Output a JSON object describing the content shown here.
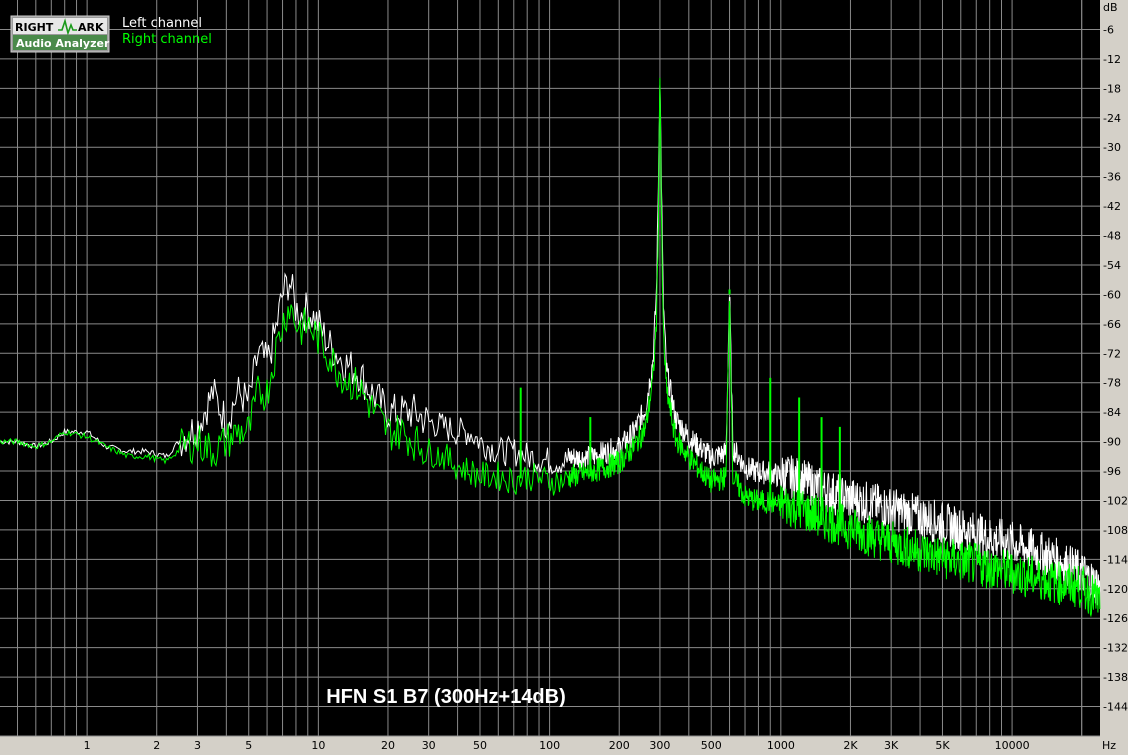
{
  "app": {
    "logo": {
      "word1": "RIGHT",
      "word2": "ARK",
      "subtitle": "Audio Analyzer"
    }
  },
  "chart_data": {
    "type": "line",
    "title": "HFN S1 B7 (300Hz+14dB)",
    "xlabel": "Hz",
    "ylabel": "dB",
    "xscale": "log",
    "xlim": [
      0.42,
      24000
    ],
    "ylim": [
      -150,
      0
    ],
    "grid": true,
    "legend_position": "top-left",
    "x_tick_labels": [
      {
        "value": 1,
        "label": "1"
      },
      {
        "value": 2,
        "label": "2"
      },
      {
        "value": 3,
        "label": "3"
      },
      {
        "value": 5,
        "label": "5"
      },
      {
        "value": 10,
        "label": "10"
      },
      {
        "value": 20,
        "label": "20"
      },
      {
        "value": 30,
        "label": "30"
      },
      {
        "value": 50,
        "label": "50"
      },
      {
        "value": 100,
        "label": "100"
      },
      {
        "value": 200,
        "label": "200"
      },
      {
        "value": 300,
        "label": "300"
      },
      {
        "value": 500,
        "label": "500"
      },
      {
        "value": 1000,
        "label": "1000"
      },
      {
        "value": 2000,
        "label": "2K"
      },
      {
        "value": 3000,
        "label": "3K"
      },
      {
        "value": 5000,
        "label": "5K"
      },
      {
        "value": 10000,
        "label": "10000"
      }
    ],
    "y_ticks": [
      -6,
      -12,
      -18,
      -24,
      -30,
      -36,
      -42,
      -48,
      -54,
      -60,
      -66,
      -72,
      -78,
      -84,
      -90,
      -96,
      -102,
      -108,
      -114,
      -120,
      -126,
      -132,
      -138,
      -144
    ],
    "series": [
      {
        "name": "Left channel",
        "color": "#ffffff",
        "x": [
          0.42,
          0.5,
          0.6,
          0.7,
          0.8,
          1.0,
          1.2,
          1.5,
          1.8,
          2.2,
          2.6,
          3.0,
          3.5,
          4.0,
          4.5,
          5.0,
          5.5,
          6.0,
          6.5,
          7.0,
          7.5,
          8.0,
          8.5,
          9.0,
          10,
          11,
          12,
          13,
          15,
          17,
          20,
          23,
          26,
          30,
          35,
          40,
          45,
          50,
          60,
          70,
          80,
          100,
          120,
          150,
          200,
          230,
          260,
          280,
          290,
          295,
          300,
          305,
          310,
          320,
          350,
          400,
          500,
          580,
          600,
          620,
          700,
          800,
          900,
          1000,
          1200,
          1500,
          2000,
          3000,
          5000,
          8000,
          10000,
          15000,
          20000,
          24000
        ],
        "y": [
          -90,
          -90,
          -91,
          -90,
          -88,
          -88,
          -91,
          -92,
          -92,
          -93,
          -89,
          -87,
          -80,
          -86,
          -80,
          -82,
          -72,
          -74,
          -68,
          -60,
          -57,
          -63,
          -64,
          -63,
          -66,
          -70,
          -72,
          -74,
          -76,
          -80,
          -84,
          -84,
          -84,
          -86,
          -87,
          -88,
          -88,
          -90,
          -92,
          -92,
          -93,
          -94,
          -94,
          -94,
          -92,
          -89,
          -84,
          -74,
          -60,
          -40,
          -16,
          -40,
          -62,
          -76,
          -86,
          -90,
          -94,
          -93,
          -60,
          -92,
          -96,
          -97,
          -97,
          -98,
          -99,
          -101,
          -103,
          -105,
          -108,
          -111,
          -112,
          -115,
          -118,
          -121
        ]
      },
      {
        "name": "Right channel",
        "color": "#00ff00",
        "x": [
          0.42,
          0.5,
          0.6,
          0.7,
          0.8,
          1.0,
          1.2,
          1.5,
          1.8,
          2.2,
          2.6,
          3.0,
          3.5,
          4.0,
          4.5,
          5.0,
          5.5,
          6.0,
          6.5,
          7.0,
          7.5,
          8.0,
          8.5,
          9.0,
          10,
          11,
          12,
          13,
          15,
          17,
          20,
          23,
          26,
          30,
          35,
          40,
          45,
          50,
          60,
          70,
          80,
          100,
          120,
          150,
          200,
          230,
          260,
          280,
          290,
          295,
          300,
          305,
          310,
          320,
          350,
          400,
          500,
          580,
          600,
          620,
          700,
          800,
          900,
          1000,
          1200,
          1500,
          2000,
          3000,
          5000,
          8000,
          10000,
          15000,
          20000,
          24000
        ],
        "y": [
          -90,
          -90,
          -91,
          -90,
          -88,
          -89,
          -91,
          -93,
          -93,
          -94,
          -91,
          -90,
          -92,
          -90,
          -88,
          -88,
          -80,
          -80,
          -72,
          -66,
          -62,
          -66,
          -67,
          -66,
          -69,
          -72,
          -75,
          -77,
          -79,
          -83,
          -88,
          -88,
          -90,
          -92,
          -93,
          -95,
          -96,
          -97,
          -97,
          -98,
          -97,
          -98,
          -98,
          -97,
          -95,
          -92,
          -88,
          -78,
          -66,
          -48,
          -14,
          -48,
          -68,
          -80,
          -90,
          -94,
          -99,
          -98,
          -60,
          -98,
          -102,
          -103,
          -103,
          -104,
          -105,
          -107,
          -109,
          -112,
          -115,
          -117,
          -118,
          -120,
          -121,
          -124
        ]
      }
    ],
    "spikes": [
      {
        "x": 300,
        "y": -14
      },
      {
        "x": 600,
        "y": -59
      },
      {
        "x": 900,
        "y": -77
      },
      {
        "x": 1200,
        "y": -81
      },
      {
        "x": 1500,
        "y": -85
      },
      {
        "x": 1800,
        "y": -87
      },
      {
        "x": 150,
        "y": -85
      },
      {
        "x": 75,
        "y": -79
      }
    ]
  }
}
